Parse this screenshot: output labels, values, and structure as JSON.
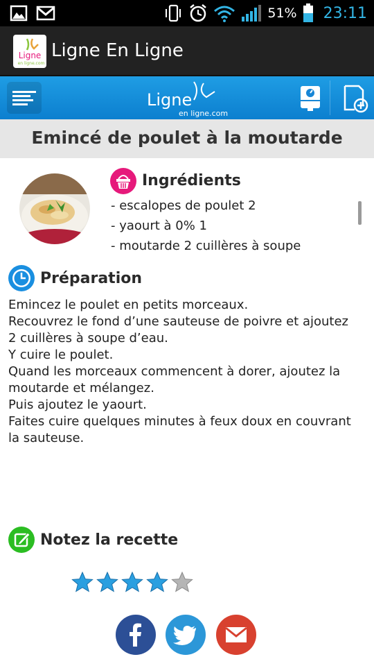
{
  "status_bar": {
    "battery_percent": "51%",
    "time": "23:11",
    "icons": [
      "image-icon",
      "gmail-icon",
      "vibrate-icon",
      "alarm-icon",
      "wifi-icon",
      "signal-icon",
      "battery-icon"
    ]
  },
  "action_bar": {
    "app_title": "Ligne En Ligne",
    "logo_text_main": "Ligne",
    "logo_text_sub": "en ligne.com"
  },
  "toolbar": {
    "logo_text_main": "Ligne",
    "logo_text_sub": "en ligne.com",
    "icons": [
      "menu-icon",
      "scale-icon",
      "add-page-icon"
    ]
  },
  "recipe": {
    "title": "Emincé de poulet à la moutarde"
  },
  "ingredients": {
    "heading": "Ingrédients",
    "items": [
      "- escalopes de poulet 2",
      "- yaourt à 0% 1",
      "-  moutarde 2 cuillères à soupe"
    ]
  },
  "preparation": {
    "heading": "Préparation",
    "lines": [
      "Emincez le poulet en petits morceaux.",
      "Recouvrez le fond d’une sauteuse de poivre et ajoutez",
      "2 cuillères à soupe d’eau.",
      "Y cuire le poulet.",
      "Quand les morceaux commencent à dorer, ajoutez la",
      "moutarde et mélangez.",
      "Puis ajoutez le yaourt.",
      "Faites cuire quelques minutes à feux doux en couvrant",
      "la sauteuse."
    ]
  },
  "rating": {
    "heading": "Notez la recette",
    "value": 4,
    "max": 5,
    "filled_color": "#2a9fe0",
    "empty_color": "#b5b5b5"
  },
  "share": {
    "buttons": [
      "facebook-icon",
      "twitter-icon",
      "mail-icon"
    ],
    "colors": {
      "facebook": "#2c4f96",
      "twitter": "#2c97d8",
      "mail": "#d8412f"
    }
  }
}
